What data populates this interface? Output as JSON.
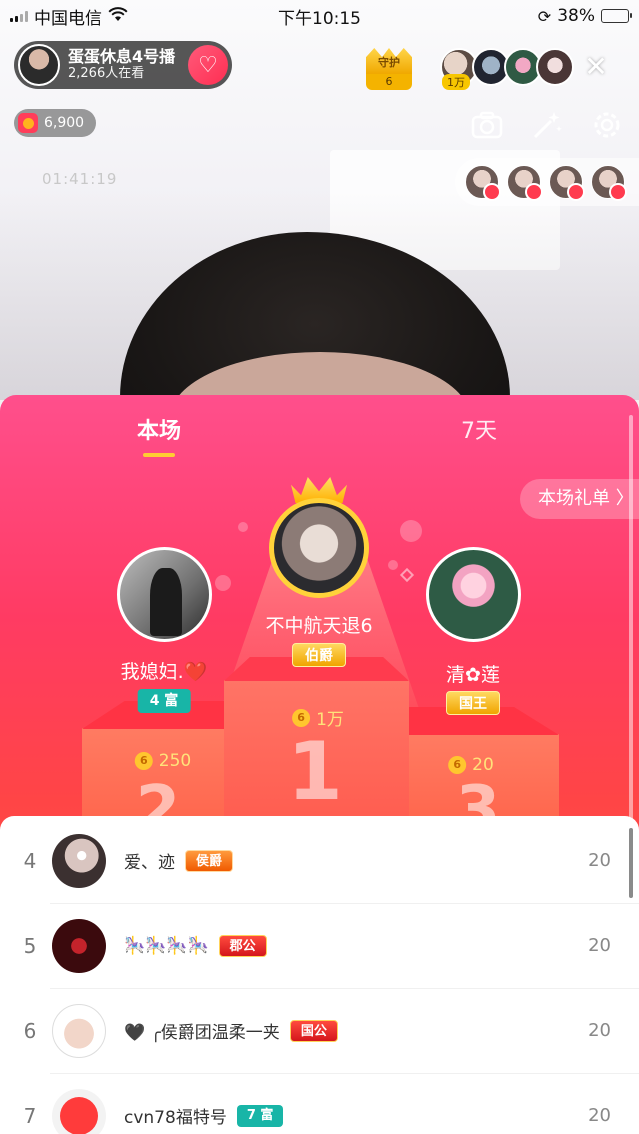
{
  "status_bar": {
    "carrier": "中国电信",
    "time": "下午10:15",
    "battery": "38%",
    "battery_level": 0.38
  },
  "header": {
    "host_name": "蛋蛋休息4号播",
    "viewers": "2,266人在看",
    "follow_icon": "heart-plus-icon",
    "coins": "6,900",
    "live_timer": "01:41:19",
    "guard_label": "守护",
    "guard_count": "6",
    "audience_tag": "1万",
    "close_label": "✕"
  },
  "tools": {
    "icons": [
      "camera-flip-icon",
      "magic-wand-icon",
      "settings-icon"
    ]
  },
  "panel": {
    "tabs": [
      {
        "label": "本场",
        "selected": true
      },
      {
        "label": "7天",
        "selected": false
      }
    ],
    "gift_list_button": "本场礼单 〉",
    "podium": [
      {
        "rank": "1",
        "name": "不中航天退6",
        "badge": "伯爵",
        "score": "1万"
      },
      {
        "rank": "2",
        "name": "我媳妇.❤️",
        "badge": "4 富",
        "score": "250"
      },
      {
        "rank": "3",
        "name": "清✿莲",
        "badge": "国王",
        "score": "20"
      }
    ],
    "coin_symbol": "6"
  },
  "list": [
    {
      "rank": "4",
      "name": "爱、迹",
      "badge": "侯爵",
      "score": "20"
    },
    {
      "rank": "5",
      "name": "🎠🎠🎠🎠",
      "badge": "郡公",
      "score": "20"
    },
    {
      "rank": "6",
      "name": "🖤 ╭侯爵团温柔一夹",
      "badge": "国公",
      "score": "20"
    },
    {
      "rank": "7",
      "name": "cvn78福特号",
      "badge": "7 富",
      "score": "20"
    }
  ],
  "colors": {
    "panel_top": "#ff4f8c",
    "panel_bottom": "#ff5a3a",
    "gold": "#ffd23a",
    "rich_badge": "#18b5a7"
  }
}
